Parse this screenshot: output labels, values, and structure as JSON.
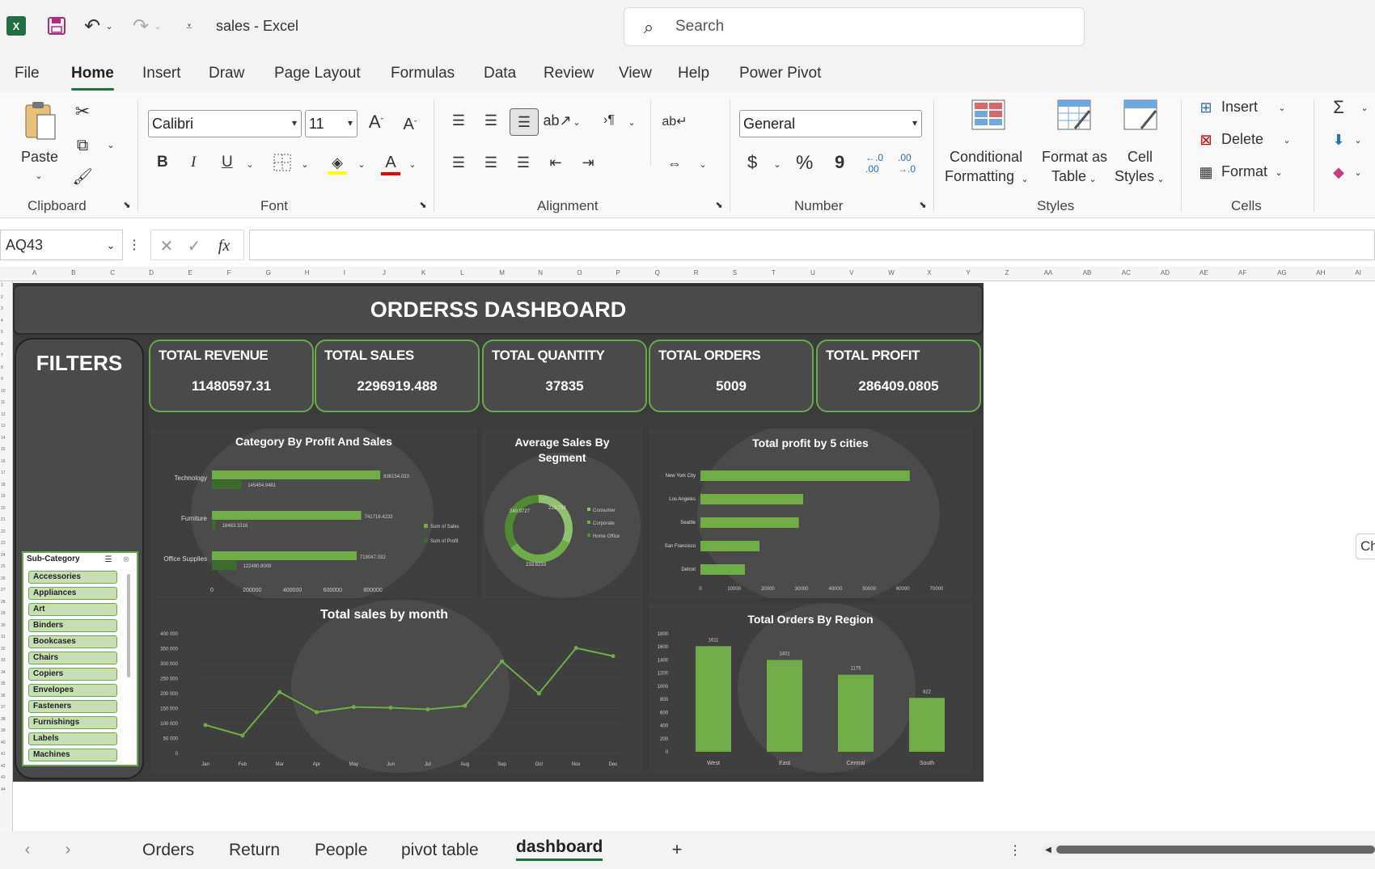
{
  "window": {
    "app_title": "sales  -  Excel",
    "search_placeholder": "Search"
  },
  "menu": [
    "File",
    "Home",
    "Insert",
    "Draw",
    "Page Layout",
    "Formulas",
    "Data",
    "Review",
    "View",
    "Help",
    "Power Pivot"
  ],
  "ribbon": {
    "clipboard": {
      "paste": "Paste",
      "label": "Clipboard"
    },
    "font": {
      "name": "Calibri",
      "size": "11",
      "label": "Font",
      "bold": "B",
      "italic": "I",
      "underline": "U"
    },
    "alignment": {
      "label": "Alignment"
    },
    "number": {
      "format": "General",
      "label": "Number",
      "currency": "$",
      "percent": "%",
      "comma": "9"
    },
    "styles": {
      "conditional": "Conditional",
      "conditional2": "Formatting",
      "format_as": "Format as",
      "format_as2": "Table",
      "cell": "Cell",
      "cell2": "Styles",
      "label": "Styles"
    },
    "cells": {
      "insert": "Insert",
      "delete": "Delete",
      "format": "Format",
      "label": "Cells"
    }
  },
  "formula": {
    "name_box": "AQ43",
    "fx": "fx",
    "value": ""
  },
  "columns": [
    "A",
    "B",
    "C",
    "D",
    "E",
    "F",
    "G",
    "H",
    "I",
    "J",
    "K",
    "L",
    "M",
    "N",
    "O",
    "P",
    "Q",
    "R",
    "S",
    "T",
    "U",
    "V",
    "W",
    "X",
    "Y",
    "Z",
    "AA",
    "AB",
    "AC",
    "AD",
    "AE",
    "AF",
    "AG",
    "AH",
    "AI"
  ],
  "dashboard": {
    "title": "ORDERSS DASHBOARD",
    "filters_title": "FILTERS",
    "kpis": [
      {
        "label": "TOTAL REVENUE",
        "value": "11480597.31"
      },
      {
        "label": "TOTAL SALES",
        "value": "2296919.488"
      },
      {
        "label": "TOTAL QUANTITY",
        "value": "37835"
      },
      {
        "label": "TOTAL ORDERS",
        "value": "5009"
      },
      {
        "label": "TOTAL PROFIT",
        "value": "286409.0805"
      }
    ],
    "slicer": {
      "title": "Sub-Category",
      "items": [
        "Accessories",
        "Appliances",
        "Art",
        "Binders",
        "Bookcases",
        "Chairs",
        "Copiers",
        "Envelopes",
        "Fasteners",
        "Furnishings",
        "Labels",
        "Machines"
      ]
    },
    "side_text": "Ch"
  },
  "chart_data": [
    {
      "type": "bar",
      "title": "Category By Profit And Sales",
      "categories": [
        "Technology",
        "Furniture",
        "Office Supplies"
      ],
      "series": [
        {
          "name": "Sum of Sales",
          "values": [
            836154.033,
            741718.4233,
            719047.032
          ],
          "labels": [
            "836154.033",
            "741718.4233",
            "719047.032"
          ]
        },
        {
          "name": "Sum of Profit",
          "values": [
            145454.9481,
            18463.3316,
            122490.8008
          ],
          "labels": [
            "145454.9481",
            "18463.3316",
            "122490.8008"
          ]
        }
      ],
      "xticks": [
        "0",
        "200000",
        "400000",
        "600000",
        "800000"
      ],
      "xlim": [
        0,
        900000
      ]
    },
    {
      "type": "pie",
      "title": "Average Sales By Segment",
      "categories": [
        "Consumer",
        "Corporate",
        "Home Office"
      ],
      "values": [
        223.733,
        233.8233,
        240.9727
      ],
      "labels": [
        "223.733",
        "233.8233",
        "240.9727"
      ]
    },
    {
      "type": "bar",
      "title": "Total profit by 5 cities",
      "categories": [
        "New York City",
        "Los Angeles",
        "Seattle",
        "San Francisco",
        "Detroit"
      ],
      "values": [
        62036.9837,
        30440.7579,
        29156.0967,
        17507.3854,
        13181.7908
      ],
      "xticks": [
        "0",
        "10000",
        "20000",
        "30000",
        "40000",
        "50000",
        "60000",
        "70000"
      ],
      "xlim": [
        0,
        70000
      ]
    },
    {
      "type": "line",
      "title": "Total sales by month",
      "categories": [
        "Jan",
        "Feb",
        "Mar",
        "Apr",
        "May",
        "Jun",
        "Jul",
        "Aug",
        "Sep",
        "Oct",
        "Nov",
        "Dec"
      ],
      "values": [
        94925,
        59751,
        205005,
        137762,
        155029,
        152718,
        147238,
        159044,
        307650,
        200322,
        352461,
        325293
      ],
      "yticks": [
        "0",
        "50 000",
        "100 000",
        "150 000",
        "200 000",
        "250 000",
        "300 000",
        "350 000",
        "400 000"
      ],
      "ylim": [
        0,
        400000
      ]
    },
    {
      "type": "bar",
      "title": "Total Orders By Region",
      "categories": [
        "West",
        "East",
        "Central",
        "South"
      ],
      "values": [
        1611,
        1401,
        1175,
        822
      ],
      "yticks": [
        "0",
        "200",
        "400",
        "600",
        "800",
        "1000",
        "1200",
        "1400",
        "1600",
        "1800"
      ],
      "ylim": [
        0,
        1800
      ]
    }
  ],
  "sheets": [
    "Orders",
    "Return",
    "People",
    "pivot table",
    "dashboard"
  ],
  "colors": {
    "excel_green": "#1e7145",
    "bar_green": "#70ad47",
    "dark_bar": "#3d6b2c",
    "panel_bg": "#3f3f3f"
  }
}
